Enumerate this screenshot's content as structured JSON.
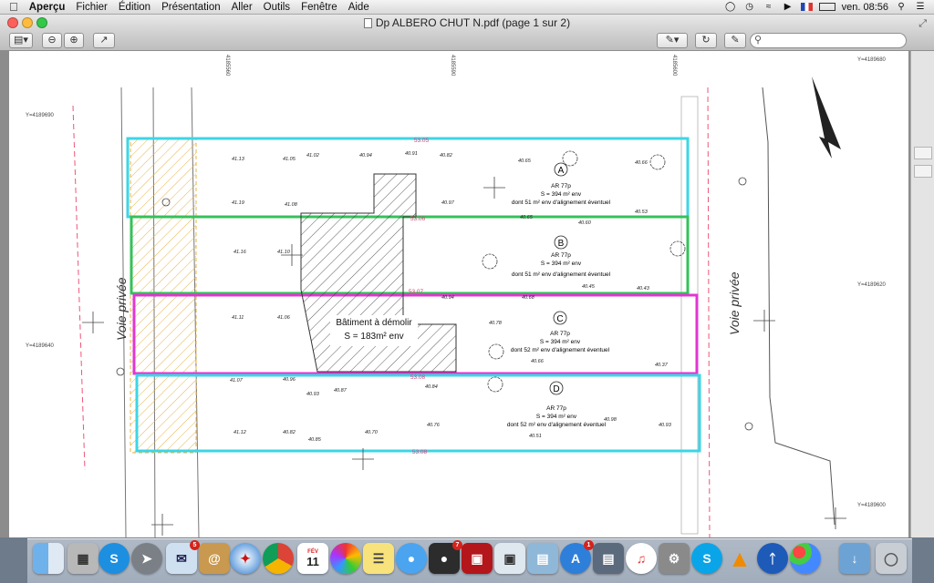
{
  "menubar": {
    "apple": "",
    "app": "Aperçu",
    "items": [
      "Fichier",
      "Édition",
      "Présentation",
      "Aller",
      "Outils",
      "Fenêtre",
      "Aide"
    ],
    "clock": "ven. 08:56",
    "status_icons": [
      "time-machine-icon",
      "clock-icon",
      "wifi-icon",
      "volume-icon",
      "flag-fr-icon",
      "battery-icon",
      "search-icon",
      "list-icon"
    ]
  },
  "window": {
    "title": "Dp ALBERO CHUT N.pdf (page 1 sur 2)",
    "search_placeholder": ""
  },
  "plan": {
    "voie_left": "Voie  privée",
    "voie_right": "Voie  privée",
    "batiment": "Bâtiment à démolir",
    "batiment_area": "S = 183m² env",
    "coords": [
      "Y=4189690",
      "Y=4189640",
      "Y=4189620",
      "Y=4189600",
      "Y=4189680",
      "Y=4189690"
    ],
    "xcoords": [
      "4185560",
      "4185590",
      "4185600"
    ],
    "lots": [
      {
        "letter": "A",
        "ref": "AR 77p",
        "area": "S = 394 m² env",
        "detail": "dont 51 m² env d'alignement éventuel"
      },
      {
        "letter": "B",
        "ref": "AR 77p",
        "area": "S = 394 m² env",
        "detail": "dont 51 m² env d'alignement éventuel"
      },
      {
        "letter": "C",
        "ref": "AR 77p",
        "area": "S = 394 m² env",
        "detail": "dont 52 m² env d'alignement éventuel"
      },
      {
        "letter": "D",
        "ref": "AR 77p",
        "area": "S = 394 m² env",
        "detail": "dont 52 m² env d'alignement éventuel"
      }
    ],
    "lengths": [
      "53.05",
      "53.06",
      "53.07",
      "53.08",
      "53.08"
    ],
    "altitudes": [
      "41.13",
      "41.05",
      "41.02",
      "40.94",
      "40.91",
      "40.82",
      "40.65",
      "40.66",
      "41.19",
      "41.08",
      "40.97",
      "40.65",
      "40.60",
      "40.53",
      "41.16",
      "41.10",
      "40.94",
      "40.68",
      "40.45",
      "40.43",
      "41.11",
      "41.06",
      "40.78",
      "40.66",
      "40.37",
      "41.07",
      "40.96",
      "40.93",
      "40.87",
      "40.84",
      "41.12",
      "40.82",
      "40.85",
      "40.70",
      "40.76",
      "40.51",
      "40.98",
      "40.93"
    ]
  },
  "dock": {
    "apps": [
      "Finder",
      "Launchpad",
      "Shazam",
      "Rocket",
      "Mail",
      "Contacts",
      "Safari",
      "Chrome",
      "Calendar",
      "Photos",
      "Notes",
      "Messages",
      "FaceTime",
      "Photo Booth",
      "Preview",
      "iPhoto",
      "App Store",
      "Image Capture",
      "iTunes",
      "System Preferences",
      "Skype",
      "VLC",
      "Bluetooth",
      "Game Center",
      "Downloads",
      "Trash"
    ],
    "calendar_day": "11",
    "calendar_month": "FÉV",
    "mail_badge": "5",
    "facetime_badge": "7",
    "appstore_badge": "1"
  }
}
